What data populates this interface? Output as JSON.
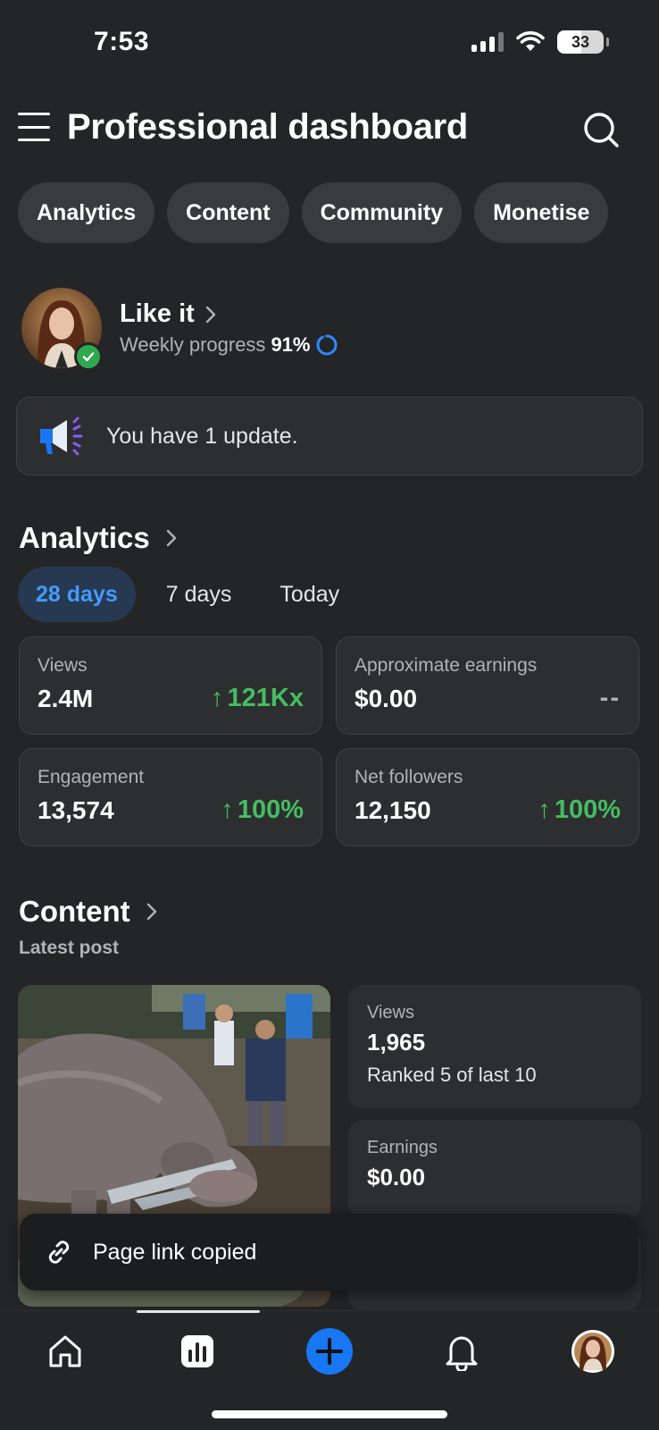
{
  "status_bar": {
    "time": "7:53",
    "battery": "33",
    "icons": [
      "cellular-signal-icon",
      "wifi-icon",
      "battery-icon"
    ]
  },
  "header": {
    "title": "Professional dashboard",
    "icons": [
      "menu-icon",
      "search-icon"
    ]
  },
  "tabs": [
    {
      "label": "Analytics"
    },
    {
      "label": "Content"
    },
    {
      "label": "Community"
    },
    {
      "label": "Monetise"
    }
  ],
  "profile": {
    "name": "Like it",
    "progress_label": "Weekly progress",
    "progress_value": "91%",
    "progress_fraction": 0.91
  },
  "update": {
    "text": "You have 1 update.",
    "icon": "megaphone-icon"
  },
  "analytics": {
    "title": "Analytics",
    "ranges": [
      {
        "label": "28 days",
        "active": true
      },
      {
        "label": "7 days",
        "active": false
      },
      {
        "label": "Today",
        "active": false
      }
    ],
    "stats": [
      {
        "label": "Views",
        "value": "2.4M",
        "change": "121Kx",
        "trend": "up"
      },
      {
        "label": "Approximate earnings",
        "value": "$0.00",
        "change": "--",
        "trend": "none"
      },
      {
        "label": "Engagement",
        "value": "13,574",
        "change": "100%",
        "trend": "up"
      },
      {
        "label": "Net followers",
        "value": "12,150",
        "change": "100%",
        "trend": "up"
      }
    ]
  },
  "content": {
    "title": "Content",
    "subtitle": "Latest post",
    "post": {
      "views_label": "Views",
      "views_value": "1,965",
      "rank_text": "Ranked 5 of last 10",
      "earnings_label": "Earnings",
      "earnings_value": "$0.00"
    }
  },
  "toast": {
    "text": "Page link copied",
    "icon": "link-icon"
  },
  "bottom_nav": {
    "items": [
      "home-icon",
      "insights-icon",
      "create-icon",
      "notifications-icon",
      "profile-avatar"
    ],
    "active": "insights-icon"
  },
  "colors": {
    "background": "#242526",
    "card": "#2d2e30",
    "chip": "#3a3b3c",
    "accent_blue": "#1877f2",
    "positive_green": "#45bd62",
    "verified_green": "#2fa84f"
  }
}
